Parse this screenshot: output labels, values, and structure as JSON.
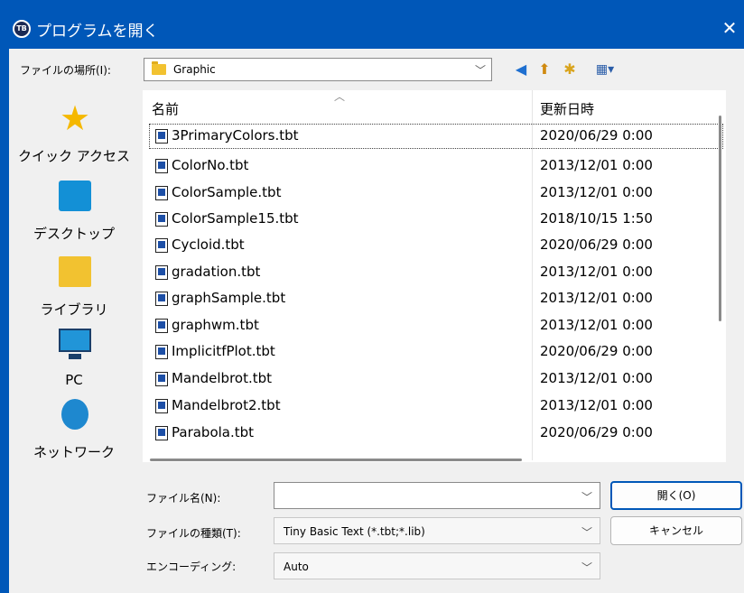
{
  "window": {
    "title": "プログラムを開く",
    "app_icon_text": "TB",
    "close_glyph": "✕",
    "accent_color": "#0057b8"
  },
  "location": {
    "label": "ファイルの場所(I):",
    "current": "Graphic"
  },
  "toolbar": {
    "back_glyph": "◀",
    "up_glyph": "⬆",
    "new_folder_glyph": "✱",
    "view_glyph": "▦▾"
  },
  "places": [
    {
      "label": "クイック アクセス",
      "icon": "star-icon"
    },
    {
      "label": "デスクトップ",
      "icon": "desktop-icon"
    },
    {
      "label": "ライブラリ",
      "icon": "library-icon"
    },
    {
      "label": "PC",
      "icon": "pc-icon"
    },
    {
      "label": "ネットワーク",
      "icon": "network-icon"
    }
  ],
  "columns": {
    "name": "名前",
    "date": "更新日時"
  },
  "files": [
    {
      "name": "3PrimaryColors.tbt",
      "date": "2020/06/29 0:00"
    },
    {
      "name": "ColorNo.tbt",
      "date": "2013/12/01 0:00"
    },
    {
      "name": "ColorSample.tbt",
      "date": "2013/12/01 0:00"
    },
    {
      "name": "ColorSample15.tbt",
      "date": "2018/10/15 1:50"
    },
    {
      "name": "Cycloid.tbt",
      "date": "2020/06/29 0:00"
    },
    {
      "name": "gradation.tbt",
      "date": "2013/12/01 0:00"
    },
    {
      "name": "graphSample.tbt",
      "date": "2013/12/01 0:00"
    },
    {
      "name": "graphwm.tbt",
      "date": "2013/12/01 0:00"
    },
    {
      "name": "ImplicitfPlot.tbt",
      "date": "2020/06/29 0:00"
    },
    {
      "name": "Mandelbrot.tbt",
      "date": "2013/12/01 0:00"
    },
    {
      "name": "Mandelbrot2.tbt",
      "date": "2013/12/01 0:00"
    },
    {
      "name": "Parabola.tbt",
      "date": "2020/06/29 0:00"
    }
  ],
  "form": {
    "filename_label": "ファイル名(N):",
    "filename_value": "",
    "filetype_label": "ファイルの種類(T):",
    "filetype_value": "Tiny Basic Text (*.tbt;*.lib)",
    "encoding_label": "エンコーディング:",
    "encoding_value": "Auto"
  },
  "buttons": {
    "open": "開く(O)",
    "cancel": "キャンセル"
  },
  "glyphs": {
    "chevron": "﹀",
    "sort_up": "︿"
  }
}
